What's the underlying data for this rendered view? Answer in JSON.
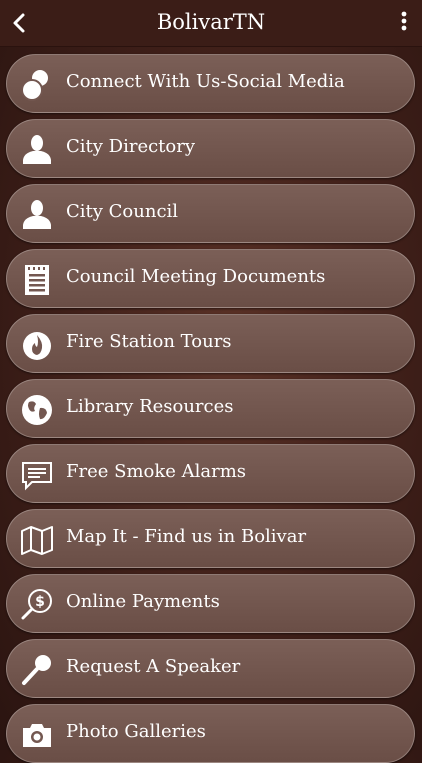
{
  "header": {
    "title": "BolivarTN",
    "back_icon": "chevron-left-icon",
    "menu_icon": "more-vertical-icon"
  },
  "colors": {
    "header_bg": "#3b1d17",
    "item_bg": "#735750",
    "text": "#ffffff"
  },
  "menu": {
    "items": [
      {
        "label": "Connect With Us-Social Media",
        "icon": "social-bubbles-icon"
      },
      {
        "label": "City Directory",
        "icon": "person-icon"
      },
      {
        "label": "City Council",
        "icon": "person-icon"
      },
      {
        "label": "Council Meeting Documents",
        "icon": "document-icon"
      },
      {
        "label": "Fire Station Tours",
        "icon": "fire-icon"
      },
      {
        "label": "Library Resources",
        "icon": "globe-icon"
      },
      {
        "label": "Free Smoke Alarms",
        "icon": "chat-message-icon"
      },
      {
        "label": "Map It - Find us in Bolivar",
        "icon": "map-icon"
      },
      {
        "label": "Online Payments",
        "icon": "dollar-magnifier-icon"
      },
      {
        "label": "Request A Speaker",
        "icon": "microphone-icon"
      },
      {
        "label": "Photo Galleries",
        "icon": "camera-icon"
      }
    ]
  }
}
